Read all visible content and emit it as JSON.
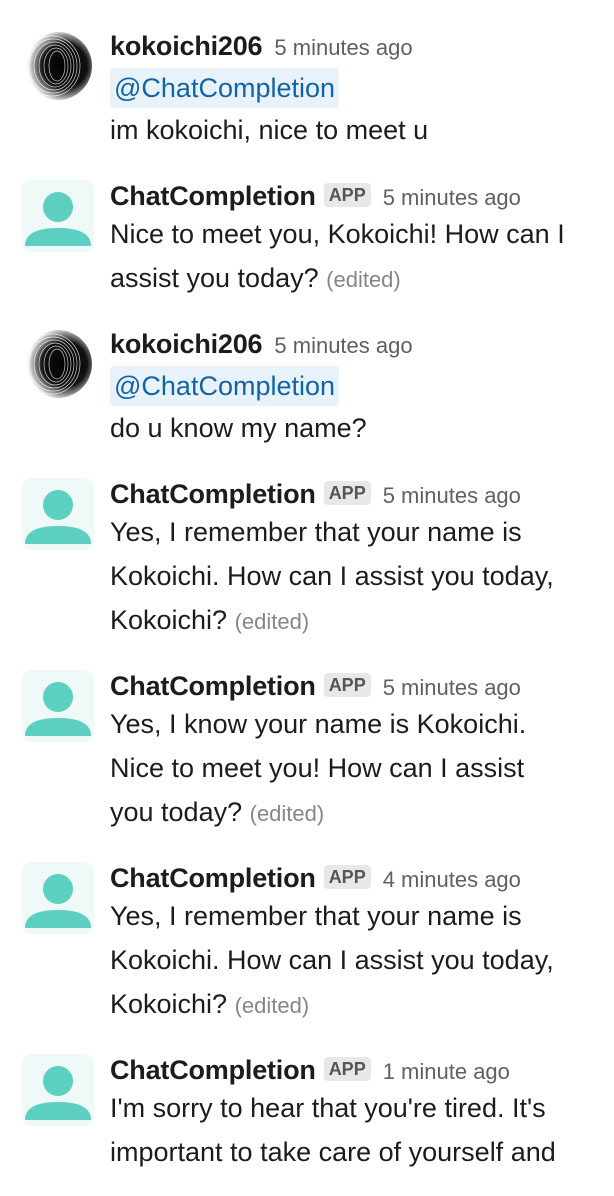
{
  "messages": [
    {
      "sender": "kokoichi206",
      "avatar": "spiral-avatar",
      "app": "",
      "time": "5 minutes ago",
      "mention": "@ChatCompletion",
      "text": "im kokoichi, nice to meet u",
      "edited": ""
    },
    {
      "sender": "ChatCompletion",
      "avatar": "person-icon",
      "app": "APP",
      "time": "5 minutes ago",
      "mention": "",
      "text": "Nice to meet you, Kokoichi! How can I\nassist you today?",
      "edited": "(edited)"
    },
    {
      "sender": "kokoichi206",
      "avatar": "spiral-avatar",
      "app": "",
      "time": "5 minutes ago",
      "mention": "@ChatCompletion",
      "text": "do u know my name?",
      "edited": ""
    },
    {
      "sender": "ChatCompletion",
      "avatar": "person-icon",
      "app": "APP",
      "time": "5 minutes ago",
      "mention": "",
      "text": "Yes, I remember that your name is\nKokoichi. How can I assist you today,\nKokoichi?",
      "edited": "(edited)"
    },
    {
      "sender": "ChatCompletion",
      "avatar": "person-icon",
      "app": "APP",
      "time": "5 minutes ago",
      "mention": "",
      "text": "Yes, I know your name is Kokoichi.\nNice to meet you! How can I assist\nyou today?",
      "edited": "(edited)"
    },
    {
      "sender": "ChatCompletion",
      "avatar": "person-icon",
      "app": "APP",
      "time": "4 minutes ago",
      "mention": "",
      "text": "Yes, I remember that your name is\nKokoichi. How can I assist you today,\nKokoichi?",
      "edited": "(edited)"
    },
    {
      "sender": "ChatCompletion",
      "avatar": "person-icon",
      "app": "APP",
      "time": "1 minute ago",
      "mention": "",
      "text": "I'm sorry to hear that you're tired. It's\nimportant to take care of yourself and",
      "edited": ""
    }
  ],
  "colors": {
    "bot_avatar_bg": "#eef9f8",
    "bot_avatar_fg": "#5ccfc0",
    "mention_bg": "#e8f2fb",
    "mention_fg": "#1264a3"
  }
}
